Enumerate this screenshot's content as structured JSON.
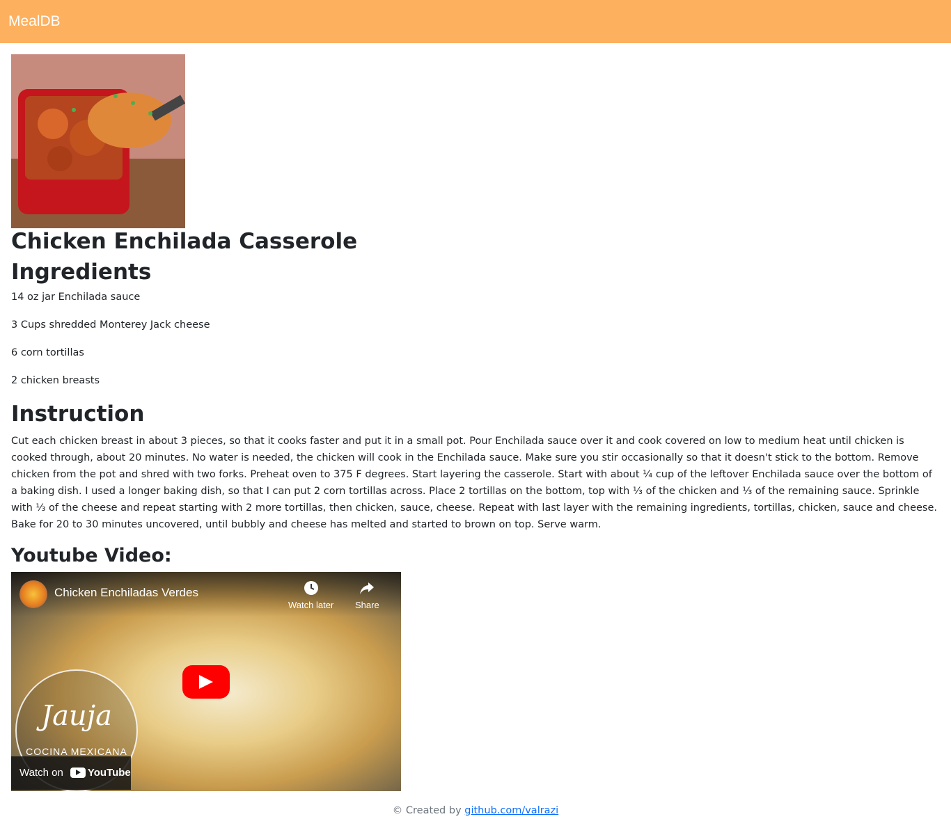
{
  "navbar": {
    "brand": "MealDB"
  },
  "meal": {
    "title": "Chicken Enchilada Casserole",
    "ingredients_heading": "Ingredients",
    "ingredients": [
      "14 oz jar Enchilada sauce",
      "3 Cups shredded Monterey Jack cheese",
      "6 corn tortillas",
      "2 chicken breasts"
    ],
    "instruction_heading": "Instruction",
    "instructions": "Cut each chicken breast in about 3 pieces, so that it cooks faster and put it in a small pot. Pour Enchilada sauce over it and cook covered on low to medium heat until chicken is cooked through, about 20 minutes. No water is needed, the chicken will cook in the Enchilada sauce. Make sure you stir occasionally so that it doesn't stick to the bottom. Remove chicken from the pot and shred with two forks. Preheat oven to 375 F degrees. Start layering the casserole. Start with about ¼ cup of the leftover Enchilada sauce over the bottom of a baking dish. I used a longer baking dish, so that I can put 2 corn tortillas across. Place 2 tortillas on the bottom, top with ⅓ of the chicken and ⅓ of the remaining sauce. Sprinkle with ⅓ of the cheese and repeat starting with 2 more tortillas, then chicken, sauce, cheese. Repeat with last layer with the remaining ingredients, tortillas, chicken, sauce and cheese. Bake for 20 to 30 minutes uncovered, until bubbly and cheese has melted and started to brown on top. Serve warm.",
    "video_heading": "Youtube Video:"
  },
  "video": {
    "title": "Chicken Enchiladas Verdes",
    "watch_later": "Watch later",
    "share": "Share",
    "watermark_script": "Jauja",
    "watermark_sub": "COCINA  MEXICANA",
    "watch_on": "Watch on",
    "youtube": "YouTube"
  },
  "footer": {
    "prefix": "© Created by ",
    "link": "github.com/valrazi"
  }
}
